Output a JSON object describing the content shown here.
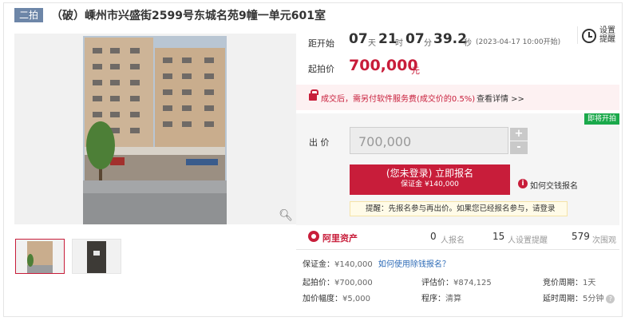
{
  "title": {
    "badge": "二拍",
    "text": "（破）嵊州市兴盛街2599号东城名苑9幢一单元601室"
  },
  "countdown": {
    "label": "距开始",
    "days": "07",
    "days_unit": "天",
    "hours": "21",
    "hours_unit": "时",
    "minutes": "07",
    "minutes_unit": "分",
    "seconds": "39.2",
    "seconds_unit": "秒",
    "start_time": "(2023-04-17 10:00开始)"
  },
  "reminder": {
    "label": "设置提醒",
    "icon": "clock-icon"
  },
  "start_price": {
    "label": "起拍价",
    "value": "700,000",
    "unit": "元"
  },
  "notice": {
    "text": "成交后，需另付软件服务费(成交价的0.5%)",
    "link": "查看详情 >>"
  },
  "bid": {
    "tag": "即将开拍",
    "label": "出 价",
    "value": "700,000",
    "plus": "+",
    "minus": "-"
  },
  "register": {
    "line1": "(您未登录) 立即报名",
    "line2": "保证金 ¥140,000",
    "how_pay": "如何交钱报名",
    "tip": "提醒：先报名参与再出价。如果您已经报名参与，请登录"
  },
  "stats": {
    "brand": "阿里资产",
    "signups": "0",
    "signups_unit": "人报名",
    "reminders": "15",
    "reminders_unit": "人设置提醒",
    "views": "579",
    "views_unit": "次围观"
  },
  "details": {
    "deposit_key": "保证金：",
    "deposit_val": "¥140,000",
    "deposit_link": "如何使用除钱报名？",
    "start_key": "起拍价：",
    "start_val": "¥700,000",
    "eval_key": "评估价：",
    "eval_val": "¥874,125",
    "cycle_key": "竞价周期：",
    "cycle_val": "1天",
    "increment_key": "加价幅度：",
    "increment_val": "¥5,000",
    "procedure_key": "程序：",
    "procedure_val": "清算",
    "delay_key": "延时周期：",
    "delay_val": "5分钟"
  },
  "colors": {
    "accent": "#c81d3a",
    "badge": "#6d86a8",
    "upcoming_tag": "#1aa94b",
    "link": "#2f6cb7"
  }
}
